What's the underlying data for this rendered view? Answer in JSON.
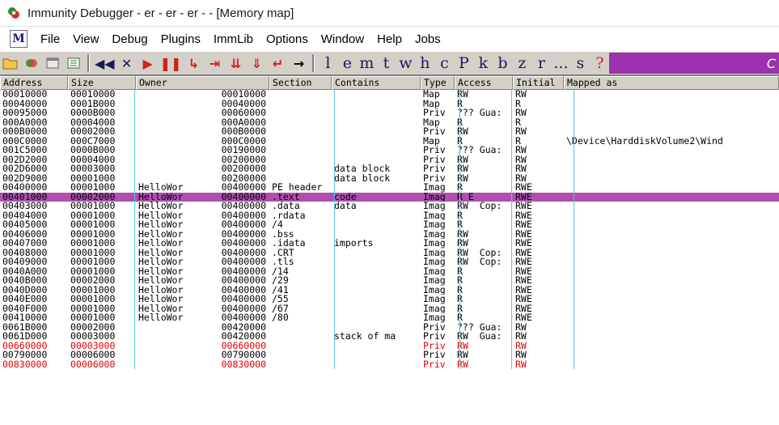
{
  "window": {
    "title": "Immunity Debugger - er - er - er - - [Memory map]"
  },
  "menu": {
    "logo": "M",
    "items": [
      "File",
      "View",
      "Debug",
      "Plugins",
      "ImmLib",
      "Options",
      "Window",
      "Help",
      "Jobs"
    ]
  },
  "toolbar": {
    "icons": [
      "open-icon",
      "restart-icon",
      "close-window-icon",
      "memory-icon",
      "rewind-icon",
      "stop-icon",
      "run-icon",
      "pause-icon",
      "step-into-icon",
      "step-over-icon",
      "trace-into-icon",
      "trace-over-icon",
      "execute-till-return-icon",
      "goto-icon"
    ],
    "letters": [
      "l",
      "e",
      "m",
      "t",
      "w",
      "h",
      "c",
      "P",
      "k",
      "b",
      "z",
      "r",
      "...",
      "s",
      "?"
    ],
    "right_label": "C"
  },
  "table": {
    "columns": [
      "Address",
      "Size",
      "Owner",
      "Section",
      "Contains",
      "Type",
      "Access",
      "Initial",
      "Mapped as"
    ],
    "selected_row": 11,
    "rows": [
      {
        "address": "00010000",
        "size": "00010000",
        "owner_name": "",
        "owner_addr": "00010000",
        "section": "",
        "contains": "",
        "type": "Map",
        "access": "RW",
        "initial": "RW",
        "mapped": ""
      },
      {
        "address": "00040000",
        "size": "0001B000",
        "owner_name": "",
        "owner_addr": "00040000",
        "section": "",
        "contains": "",
        "type": "Map",
        "access": "R",
        "initial": "R",
        "mapped": ""
      },
      {
        "address": "00095000",
        "size": "0000B000",
        "owner_name": "",
        "owner_addr": "00060000",
        "section": "",
        "contains": "",
        "type": "Priv",
        "access": "??? Gua:",
        "initial": "RW",
        "mapped": ""
      },
      {
        "address": "000A0000",
        "size": "00004000",
        "owner_name": "",
        "owner_addr": "000A0000",
        "section": "",
        "contains": "",
        "type": "Map",
        "access": "R",
        "initial": "R",
        "mapped": ""
      },
      {
        "address": "000B0000",
        "size": "00002000",
        "owner_name": "",
        "owner_addr": "000B0000",
        "section": "",
        "contains": "",
        "type": "Priv",
        "access": "RW",
        "initial": "RW",
        "mapped": ""
      },
      {
        "address": "000C0000",
        "size": "000C7000",
        "owner_name": "",
        "owner_addr": "000C0000",
        "section": "",
        "contains": "",
        "type": "Map",
        "access": "R",
        "initial": "R",
        "mapped": "\\Device\\HarddiskVolume2\\Wind"
      },
      {
        "address": "001C5000",
        "size": "0000B000",
        "owner_name": "",
        "owner_addr": "00190000",
        "section": "",
        "contains": "",
        "type": "Priv",
        "access": "??? Gua:",
        "initial": "RW",
        "mapped": ""
      },
      {
        "address": "002D2000",
        "size": "00004000",
        "owner_name": "",
        "owner_addr": "00200000",
        "section": "",
        "contains": "",
        "type": "Priv",
        "access": "RW",
        "initial": "RW",
        "mapped": ""
      },
      {
        "address": "002D6000",
        "size": "00003000",
        "owner_name": "",
        "owner_addr": "00200000",
        "section": "",
        "contains": "data block",
        "type": "Priv",
        "access": "RW",
        "initial": "RW",
        "mapped": ""
      },
      {
        "address": "002D9000",
        "size": "00001000",
        "owner_name": "",
        "owner_addr": "00200000",
        "section": "",
        "contains": "data block",
        "type": "Priv",
        "access": "RW",
        "initial": "RW",
        "mapped": ""
      },
      {
        "address": "00400000",
        "size": "00001000",
        "owner_name": "HelloWor",
        "owner_addr": "00400000",
        "section": "PE header",
        "contains": "",
        "type": "Imag",
        "access": "R",
        "initial": "RWE",
        "mapped": ""
      },
      {
        "address": "00401000",
        "size": "00002000",
        "owner_name": "HelloWor",
        "owner_addr": "00400000",
        "section": ".text",
        "contains": "code",
        "type": "Imag",
        "access": "R E",
        "initial": "RWE",
        "mapped": ""
      },
      {
        "address": "00403000",
        "size": "00001000",
        "owner_name": "HelloWor",
        "owner_addr": "00400000",
        "section": ".data",
        "contains": "data",
        "type": "Imag",
        "access": "RW  Cop:",
        "initial": "RWE",
        "mapped": ""
      },
      {
        "address": "00404000",
        "size": "00001000",
        "owner_name": "HelloWor",
        "owner_addr": "00400000",
        "section": ".rdata",
        "contains": "",
        "type": "Imag",
        "access": "R",
        "initial": "RWE",
        "mapped": ""
      },
      {
        "address": "00405000",
        "size": "00001000",
        "owner_name": "HelloWor",
        "owner_addr": "00400000",
        "section": "/4",
        "contains": "",
        "type": "Imag",
        "access": "R",
        "initial": "RWE",
        "mapped": ""
      },
      {
        "address": "00406000",
        "size": "00001000",
        "owner_name": "HelloWor",
        "owner_addr": "00400000",
        "section": ".bss",
        "contains": "",
        "type": "Imag",
        "access": "RW",
        "initial": "RWE",
        "mapped": ""
      },
      {
        "address": "00407000",
        "size": "00001000",
        "owner_name": "HelloWor",
        "owner_addr": "00400000",
        "section": ".idata",
        "contains": "imports",
        "type": "Imag",
        "access": "RW",
        "initial": "RWE",
        "mapped": ""
      },
      {
        "address": "00408000",
        "size": "00001000",
        "owner_name": "HelloWor",
        "owner_addr": "00400000",
        "section": ".CRT",
        "contains": "",
        "type": "Imag",
        "access": "RW  Cop:",
        "initial": "RWE",
        "mapped": ""
      },
      {
        "address": "00409000",
        "size": "00001000",
        "owner_name": "HelloWor",
        "owner_addr": "00400000",
        "section": ".tls",
        "contains": "",
        "type": "Imag",
        "access": "RW  Cop:",
        "initial": "RWE",
        "mapped": ""
      },
      {
        "address": "0040A000",
        "size": "00001000",
        "owner_name": "HelloWor",
        "owner_addr": "00400000",
        "section": "/14",
        "contains": "",
        "type": "Imag",
        "access": "R",
        "initial": "RWE",
        "mapped": ""
      },
      {
        "address": "0040B000",
        "size": "00002000",
        "owner_name": "HelloWor",
        "owner_addr": "00400000",
        "section": "/29",
        "contains": "",
        "type": "Imag",
        "access": "R",
        "initial": "RWE",
        "mapped": ""
      },
      {
        "address": "0040D000",
        "size": "00001000",
        "owner_name": "HelloWor",
        "owner_addr": "00400000",
        "section": "/41",
        "contains": "",
        "type": "Imag",
        "access": "R",
        "initial": "RWE",
        "mapped": ""
      },
      {
        "address": "0040E000",
        "size": "00001000",
        "owner_name": "HelloWor",
        "owner_addr": "00400000",
        "section": "/55",
        "contains": "",
        "type": "Imag",
        "access": "R",
        "initial": "RWE",
        "mapped": ""
      },
      {
        "address": "0040F000",
        "size": "00001000",
        "owner_name": "HelloWor",
        "owner_addr": "00400000",
        "section": "/67",
        "contains": "",
        "type": "Imag",
        "access": "R",
        "initial": "RWE",
        "mapped": ""
      },
      {
        "address": "00410000",
        "size": "00001000",
        "owner_name": "HelloWor",
        "owner_addr": "00400000",
        "section": "/80",
        "contains": "",
        "type": "Imag",
        "access": "R",
        "initial": "RWE",
        "mapped": ""
      },
      {
        "address": "0061B000",
        "size": "00002000",
        "owner_name": "",
        "owner_addr": "00420000",
        "section": "",
        "contains": "",
        "type": "Priv",
        "access": "??? Gua:",
        "initial": "RW",
        "mapped": ""
      },
      {
        "address": "0061D000",
        "size": "00003000",
        "owner_name": "",
        "owner_addr": "00420000",
        "section": "",
        "contains": "stack of ma",
        "type": "Priv",
        "access": "RW  Gua:",
        "initial": "RW",
        "mapped": ""
      },
      {
        "address": "00660000",
        "size": "00003000",
        "owner_name": "",
        "owner_addr": "00660000",
        "section": "",
        "contains": "",
        "type": "Priv",
        "access": "RW",
        "initial": "RW",
        "mapped": "",
        "highlight": "red"
      },
      {
        "address": "00790000",
        "size": "00006000",
        "owner_name": "",
        "owner_addr": "00790000",
        "section": "",
        "contains": "",
        "type": "Priv",
        "access": "RW",
        "initial": "RW",
        "mapped": ""
      },
      {
        "address": "00830000",
        "size": "00006000",
        "owner_name": "",
        "owner_addr": "00830000",
        "section": "",
        "contains": "",
        "type": "Priv",
        "access": "RW",
        "initial": "RW",
        "mapped": "",
        "highlight": "red"
      }
    ]
  }
}
